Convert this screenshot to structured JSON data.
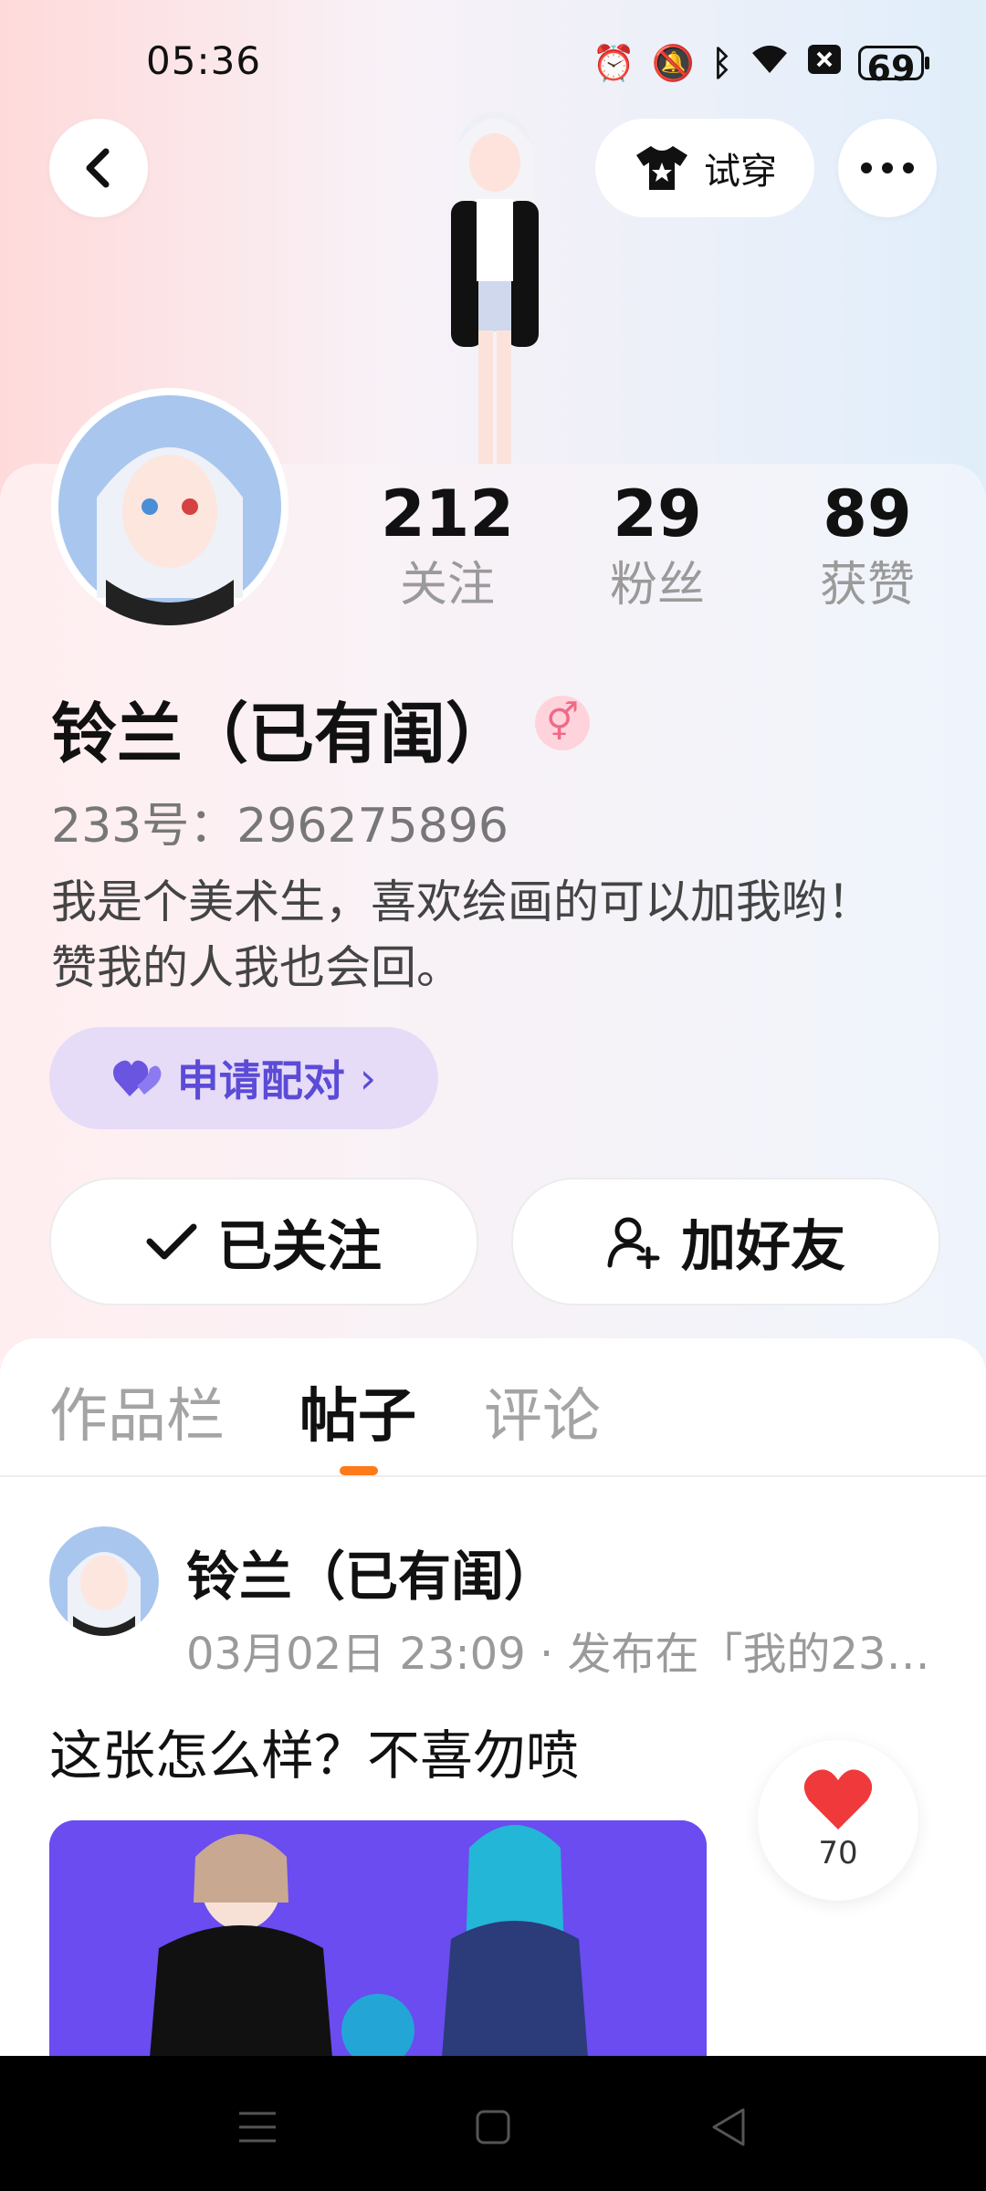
{
  "status_bar": {
    "time": "05:36",
    "icons": [
      "alarm-icon",
      "mute-icon",
      "bluetooth-icon",
      "wifi-icon",
      "close-box-icon"
    ],
    "battery": "69"
  },
  "header": {
    "back_icon": "chevron-left-icon",
    "tryon_label": "试穿",
    "more_icon": "more-horizontal-icon"
  },
  "stats": [
    {
      "value": "212",
      "label": "关注"
    },
    {
      "value": "29",
      "label": "粉丝"
    },
    {
      "value": "89",
      "label": "获赞"
    }
  ],
  "profile": {
    "name": "铃兰（已有闺）",
    "gender_icon": "female-icon",
    "uid": "233号：296275896",
    "bio": "我是个美术生，喜欢绘画的可以加我哟！赞我的人我也会回。"
  },
  "match_button": {
    "label": "申请配对",
    "icon": "heart-icon",
    "chevron": "›"
  },
  "follow_button": {
    "label": "已关注",
    "icon": "check-icon"
  },
  "add_friend_button": {
    "label": "加好友",
    "icon": "add-user-icon"
  },
  "tabs": [
    {
      "label": "作品栏",
      "active": false
    },
    {
      "label": "帖子",
      "active": true
    },
    {
      "label": "评论",
      "active": false
    }
  ],
  "post": {
    "author": "铃兰（已有闺）",
    "meta": "03月02日 23:09 · 发布在「我的23…",
    "text": "这张怎么样？不喜勿喷",
    "likes": "70"
  },
  "colors": {
    "accent_orange": "#ff7a1a",
    "match_purple": "#5b4bd6",
    "match_bg": "#e6dcf8",
    "image_bg": "#6a4cf0"
  }
}
